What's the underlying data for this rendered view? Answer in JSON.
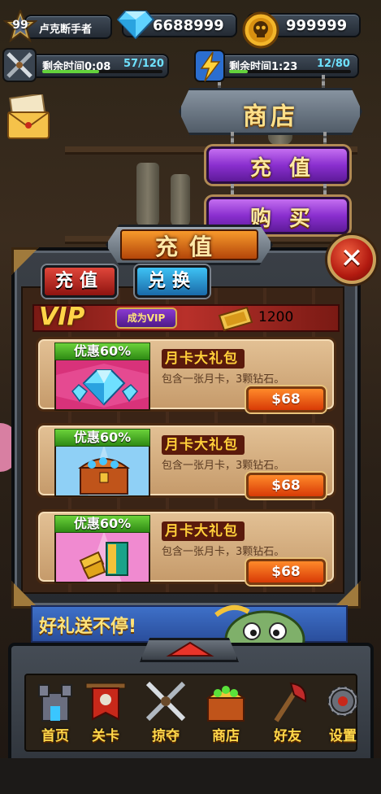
{
  "player": {
    "level": "99",
    "name": "卢克断手者"
  },
  "resources": {
    "diamonds": "6688999",
    "gold": "999999"
  },
  "energy": [
    {
      "label": "剩余时间0:08",
      "count": "57/120",
      "fill": 0.475
    },
    {
      "label": "剩余时间1:23",
      "count": "12/80",
      "fill": 0.15
    }
  ],
  "shop_menu": {
    "title": "商店",
    "recharge": "充值",
    "buy": "购买"
  },
  "panel": {
    "title": "充值",
    "close": "✕",
    "tabs": {
      "recharge": "充值",
      "exchange": "兑换"
    },
    "vip": {
      "label": "VIP",
      "become_vip": "成为VIP",
      "amount": "1200"
    },
    "products": [
      {
        "discount": "优惠60%",
        "title": "月卡大礼包",
        "desc": "包含一张月卡，3颗钻石。",
        "price": "$68",
        "image": "diamond-pile"
      },
      {
        "discount": "优惠60%",
        "title": "月卡大礼包",
        "desc": "包含一张月卡，3颗钻石。",
        "price": "$68",
        "image": "treasure-chest"
      },
      {
        "discount": "优惠60%",
        "title": "月卡大礼包",
        "desc": "包含一张月卡，3颗钻石。",
        "price": "$68",
        "image": "gold-bars"
      }
    ]
  },
  "promo": {
    "text": "好礼送不停!"
  },
  "nav": [
    {
      "label": "首页",
      "icon": "castle-icon"
    },
    {
      "label": "关卡",
      "icon": "banner-icon"
    },
    {
      "label": "掠夺",
      "icon": "crossed-swords-icon"
    },
    {
      "label": "商店",
      "icon": "treasure-chest-icon"
    },
    {
      "label": "好友",
      "icon": "axe-icon"
    },
    {
      "label": "设置",
      "icon": "gear-icon"
    }
  ],
  "colors": {
    "accent_gold": "#ffd84a",
    "vip_red": "#b8302a",
    "price_orange": "#ff8a2a",
    "discount_green": "#6bd23a",
    "purple": "#8a2fcf"
  }
}
